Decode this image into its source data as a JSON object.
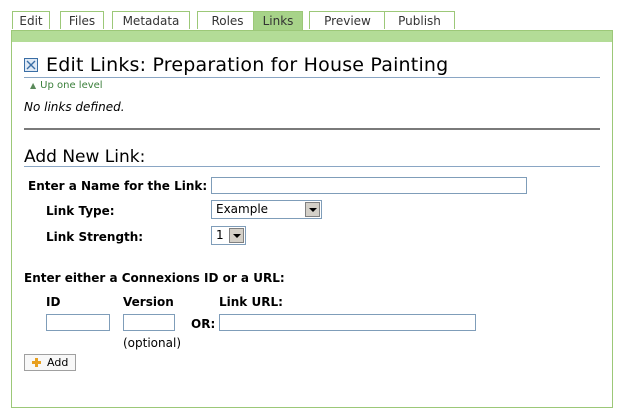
{
  "tabs": [
    {
      "label": "Edit",
      "active": false
    },
    {
      "label": "Files",
      "active": false
    },
    {
      "label": "Metadata",
      "active": false
    },
    {
      "label": "Roles",
      "active": false
    },
    {
      "label": "Links",
      "active": true
    },
    {
      "label": "Preview",
      "active": false
    },
    {
      "label": "Publish",
      "active": false
    }
  ],
  "header": {
    "title": "Edit Links: Preparation for House Painting",
    "up_link": "Up one level"
  },
  "status": {
    "no_links": "No links defined."
  },
  "add_form": {
    "title": "Add New Link:",
    "name_label": "Enter a Name for the Link:",
    "name_value": "",
    "type_label": "Link Type:",
    "type_value": "Example",
    "strength_label": "Link Strength:",
    "strength_value": "1",
    "either_label": "Enter either a Connexions ID or a URL:",
    "id_label": "ID",
    "version_label": "Version",
    "url_label": "Link URL:",
    "or_label": "OR:",
    "optional_label": "(optional)",
    "add_button": "Add"
  },
  "colors": {
    "accent_green": "#a7d389",
    "border_green": "#9cc878",
    "rule_blue": "#8aa6c4"
  }
}
